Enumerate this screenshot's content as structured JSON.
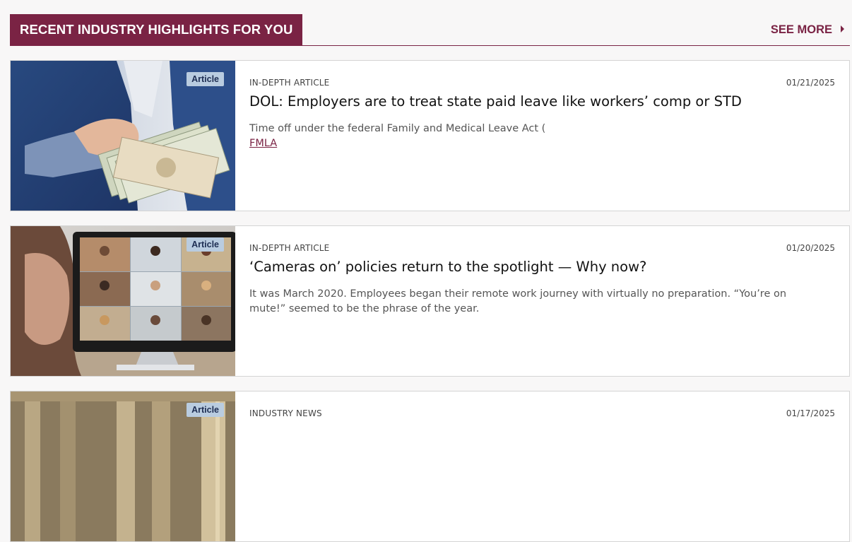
{
  "header": {
    "title": "RECENT INDUSTRY HIGHLIGHTS FOR YOU",
    "see_more": "SEE MORE"
  },
  "cards": [
    {
      "badge": "Article",
      "kind": "IN-DEPTH ARTICLE",
      "date": "01/21/2025",
      "title": "DOL: Employers are to treat state paid leave like workers’ comp or STD",
      "excerpt": "Time off under the federal Family and Medical Leave Act (",
      "excerpt_link": "FMLA"
    },
    {
      "badge": "Article",
      "kind": "IN-DEPTH ARTICLE",
      "date": "01/20/2025",
      "title": "‘Cameras on’ policies return to the spotlight — Why now?",
      "excerpt": "It was March 2020. Employees began their remote work journey with virtually no preparation. “You’re on mute!” seemed to be the phrase of the year."
    },
    {
      "badge": "Article",
      "kind": "INDUSTRY NEWS",
      "date": "01/17/2025"
    }
  ],
  "colors": {
    "brand": "#7a2344",
    "badge_bg": "#b9cce0",
    "badge_text": "#1d2d52"
  }
}
